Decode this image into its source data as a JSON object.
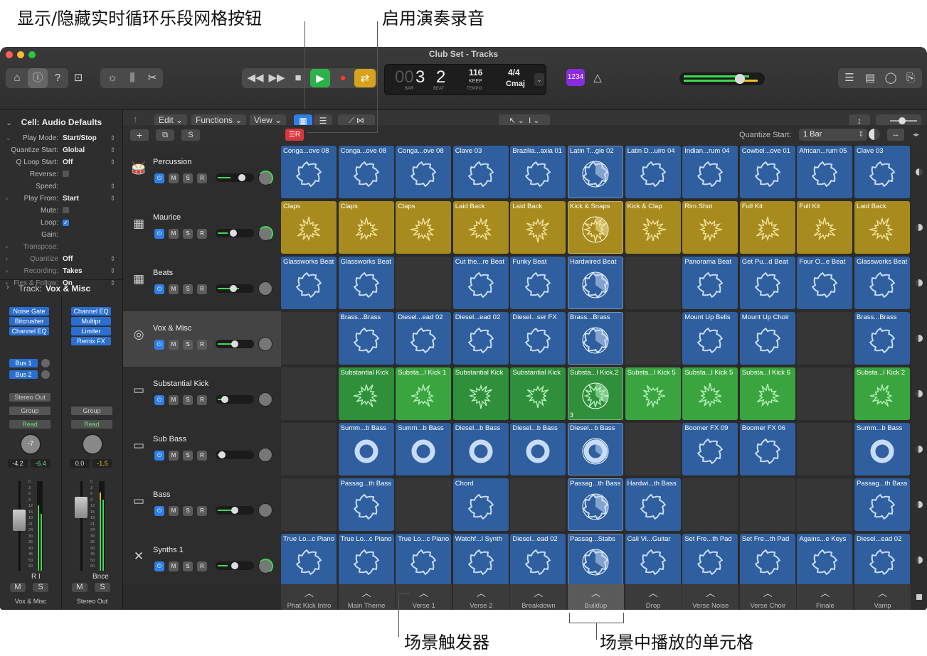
{
  "callouts": {
    "grid_button": "显示/隐藏实时循环乐段网格按钮",
    "perf_record": "启用演奏录音",
    "scene_trigger": "场景触发器",
    "playing_cells": "场景中播放的单元格"
  },
  "window": {
    "title": "Club Set - Tracks"
  },
  "lcd": {
    "bar_dim": "00",
    "bar": "3",
    "beat": "2",
    "bar_label": "BAR",
    "beat_label": "BEAT",
    "tempo": "116",
    "tempo_mode": "KEEP",
    "tempo_label": "TEMPO",
    "sig": "4/4",
    "key": "Cmaj"
  },
  "counter_badge": "1234",
  "inspector": {
    "header": "Cell: Audio Defaults",
    "params": [
      {
        "key": "Play Mode:",
        "value": "Start/Stop"
      },
      {
        "key": "Quantize Start:",
        "value": "Global"
      },
      {
        "key": "Q Loop Start:",
        "value": "Off"
      },
      {
        "key": "Reverse:",
        "value": ""
      },
      {
        "key": "Speed:",
        "value": ""
      },
      {
        "key": "Play From:",
        "value": "Start"
      },
      {
        "key": "Mute:",
        "value": ""
      },
      {
        "key": "Loop:",
        "value": ""
      },
      {
        "key": "Gain:",
        "value": ""
      },
      {
        "key": "Transpose:",
        "value": ""
      },
      {
        "key": "Quantize",
        "value": "Off"
      },
      {
        "key": "Recording:",
        "value": "Takes"
      },
      {
        "key": "Flex & Follow:",
        "value": "On"
      }
    ],
    "track_label": "Track:",
    "track_name": "Vox & Misc",
    "strip1": {
      "plugins": [
        "Noise Gate",
        "Bitcrusher",
        "Channel EQ"
      ],
      "sends": [
        "Bus 1",
        "Bus 2"
      ],
      "output": "Stereo Out",
      "group": "Group",
      "automation": "Read",
      "pan_value": "-7",
      "vol": "-4.2",
      "peak": "-6.4",
      "ri": "R I",
      "m": "M",
      "s": "S",
      "name": "Vox & Misc"
    },
    "strip2": {
      "plugins": [
        "Channel EQ",
        "Multipr",
        "Limiter",
        "Remix FX"
      ],
      "group": "Group",
      "automation": "Read",
      "vol": "0.0",
      "peak": "-1.5",
      "bnce": "Bnce",
      "m": "M",
      "s": "S",
      "name": "Stereo Out"
    },
    "meter_scale": [
      "0",
      "3",
      "6",
      "9",
      "12",
      "15",
      "18",
      "21",
      "24",
      "30",
      "35",
      "40",
      "45",
      "50",
      "60"
    ]
  },
  "toolbar": {
    "edit": "Edit",
    "functions": "Functions",
    "view": "View",
    "quantize_label": "Quantize Start:",
    "quantize_value": "1 Bar",
    "add": "+",
    "s": "S"
  },
  "tracks": [
    {
      "name": "Percussion",
      "icon": "percussion-icon",
      "glyph": "🥁"
    },
    {
      "name": "Maurice",
      "icon": "drum-machine-icon",
      "glyph": "▦"
    },
    {
      "name": "Beats",
      "icon": "drum-machine-icon",
      "glyph": "▦"
    },
    {
      "name": "Vox & Misc",
      "icon": "turntable-icon",
      "glyph": "◎"
    },
    {
      "name": "Substantial Kick",
      "icon": "synth-icon",
      "glyph": "▭"
    },
    {
      "name": "Sub Bass",
      "icon": "synth-icon",
      "glyph": "▭"
    },
    {
      "name": "Bass",
      "icon": "synth-icon",
      "glyph": "▭"
    },
    {
      "name": "Synths 1",
      "icon": "keyboard-stand-icon",
      "glyph": "✕"
    }
  ],
  "track_buttons": {
    "m": "M",
    "s": "S",
    "r": "R"
  },
  "colors": {
    "blue": "#2f5f9e",
    "yellow": "#a88b1e",
    "green": "#2f8f3a",
    "bright_green": "#3aa53f"
  },
  "grid": [
    [
      "Conga...ove 08",
      "Conga...ove 08",
      "Conga...ove 08",
      "Clave 03",
      "Brazilia...axia 01",
      "Latin T...gle 02",
      "Latin D...uiro 04",
      "Indian...rum 04",
      "Cowbel...ove 01",
      "African...rum 05",
      "Clave 03"
    ],
    [
      "Claps",
      "Claps",
      "Claps",
      "Laid Back",
      "Laid Back",
      "Kick & Snaps",
      "Kick & Clap",
      "Rim Shot",
      "Full Kit",
      "Full Kit",
      "Laid Back"
    ],
    [
      "Glassworks Beat",
      "Glassworks Beat",
      "",
      "Cut the...re Beat",
      "Funky Beat",
      "Hardwired Beat",
      "",
      "Panorama Beat",
      "Get Pu...d Beat",
      "Four O...e Beat",
      "Glassworks Beat"
    ],
    [
      "",
      "Brass...Brass",
      "Diesel...ead 02",
      "Diesel...ead 02",
      "Diesel...ser FX",
      "Brass...Brass",
      "",
      "Mount Up Bells",
      "Mount Up Choir",
      "",
      "Brass...Brass"
    ],
    [
      "",
      "Substantial Kick",
      "Substa...l Kick 1",
      "Substantial Kick",
      "Substantial Kick",
      "Substa...l Kick.2",
      "Substa...l Kick 5",
      "Substa...l Kick 5",
      "Substa...l Kick 6",
      "",
      "Substa...l Kick 2"
    ],
    [
      "",
      "Summ...b Bass",
      "Summ...b Bass",
      "Diesel...b Bass",
      "Diesel...b Bass",
      "Diesel...b Bass",
      "",
      "Boomer FX 09",
      "Boomer FX 06",
      "",
      "Summ...b Bass"
    ],
    [
      "",
      "Passag...th Bass",
      "",
      "Chord",
      "",
      "Passag...th Bass",
      "Hardwi...th Bass",
      "",
      "",
      "",
      "Passag...th Bass"
    ],
    [
      "True Lo...c Piano",
      "True Lo...c Piano",
      "True Lo...c Piano",
      "Watchf...l Synth",
      "Diesel...ead 02",
      "Passag...Stabs",
      "Cali Vi...Guitar",
      "Set Fre...th Pad",
      "Set Fre...th Pad",
      "Agains...e Keys",
      "Diesel...ead 02"
    ]
  ],
  "playing_cell_badge": "3",
  "scenes": [
    "Phat Kick Intro",
    "Main Theme",
    "Verse 1",
    "Verse 2",
    "Breakdown",
    "Buildup",
    "Drop",
    "Verse Noise",
    "Verse Choir",
    "Finale",
    "Vamp"
  ],
  "scene_arrow": "︿"
}
